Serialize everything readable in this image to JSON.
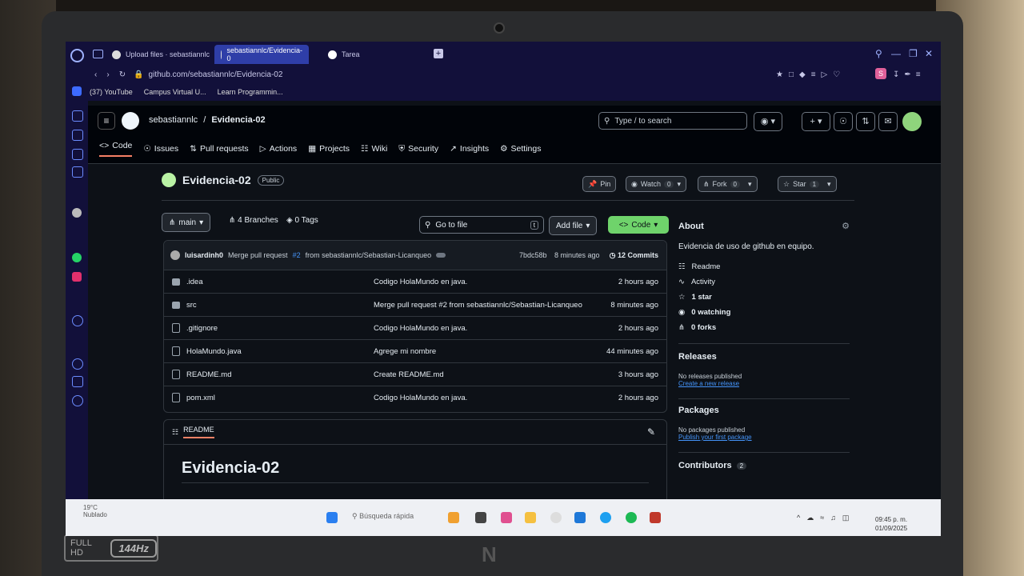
{
  "browser": {
    "tabs": [
      {
        "label": "Upload files · sebastiannlc"
      },
      {
        "label": "sebastiannlc/Evidencia-0"
      },
      {
        "label": "Tarea"
      }
    ],
    "url": "github.com/sebastiannlc/Evidencia-02",
    "bookmarks": [
      "(37) YouTube",
      "Campus Virtual U...",
      "Learn Programmin..."
    ]
  },
  "header": {
    "owner": "sebastiannlc",
    "separator": "/",
    "repo": "Evidencia-02",
    "search_placeholder": "Type / to search"
  },
  "repo_nav": [
    {
      "label": "Code"
    },
    {
      "label": "Issues"
    },
    {
      "label": "Pull requests"
    },
    {
      "label": "Actions"
    },
    {
      "label": "Projects"
    },
    {
      "label": "Wiki"
    },
    {
      "label": "Security"
    },
    {
      "label": "Insights"
    },
    {
      "label": "Settings"
    }
  ],
  "repo": {
    "name": "Evidencia-02",
    "visibility": "Public",
    "pin_label": "Pin",
    "watch_label": "Watch",
    "watch_count": "0",
    "fork_label": "Fork",
    "fork_count": "0",
    "star_label": "Star",
    "star_count": "1"
  },
  "toolbar": {
    "branch": "main",
    "branches": "4 Branches",
    "tags": "0 Tags",
    "go_to_file": "Go to file",
    "shortcut": "t",
    "add_file": "Add file",
    "code": "Code"
  },
  "latest_commit": {
    "author": "luisardinh0",
    "message_prefix": "Merge pull request",
    "pr": "#2",
    "message_suffix": "from sebastiannlc/Sebastian-Licanqueo",
    "hash": "7bdc58b",
    "time": "8 minutes ago",
    "commits": "12 Commits"
  },
  "files": [
    {
      "name": ".idea",
      "type": "folder",
      "message": "Codigo HolaMundo en java.",
      "time": "2 hours ago"
    },
    {
      "name": "src",
      "type": "folder",
      "message": "Merge pull request #2 from sebastiannlc/Sebastian-Licanqueo",
      "time": "8 minutes ago"
    },
    {
      "name": ".gitignore",
      "type": "file",
      "message": "Codigo HolaMundo en java.",
      "time": "2 hours ago"
    },
    {
      "name": "HolaMundo.java",
      "type": "file",
      "message": "Agrege mi nombre",
      "time": "44 minutes ago"
    },
    {
      "name": "README.md",
      "type": "file",
      "message": "Create README.md",
      "time": "3 hours ago"
    },
    {
      "name": "pom.xml",
      "type": "file",
      "message": "Codigo HolaMundo en java.",
      "time": "2 hours ago"
    }
  ],
  "readme": {
    "tab": "README",
    "title": "Evidencia-02"
  },
  "about": {
    "heading": "About",
    "description": "Evidencia de uso de github en equipo.",
    "items": [
      "Readme",
      "Activity",
      "1 star",
      "0 watching",
      "0 forks"
    ]
  },
  "releases": {
    "heading": "Releases",
    "none": "No releases published",
    "link": "Create a new release"
  },
  "packages": {
    "heading": "Packages",
    "none": "No packages published",
    "link": "Publish your first package"
  },
  "contributors": {
    "heading": "Contributors",
    "count": "2"
  },
  "taskbar": {
    "weather_temp": "19°C",
    "weather_desc": "Nublado",
    "search": "Búsqueda rápida",
    "time": "09:45 p. m.",
    "date": "01/09/2025"
  },
  "colors": {
    "accent_green": "#6fd36b",
    "link_blue": "#4493f8",
    "tab_active": "#2f3ea8",
    "nav_underline": "#f78166"
  },
  "bezel": {
    "full_hd": "FULL HD",
    "refresh": "144Hz"
  }
}
